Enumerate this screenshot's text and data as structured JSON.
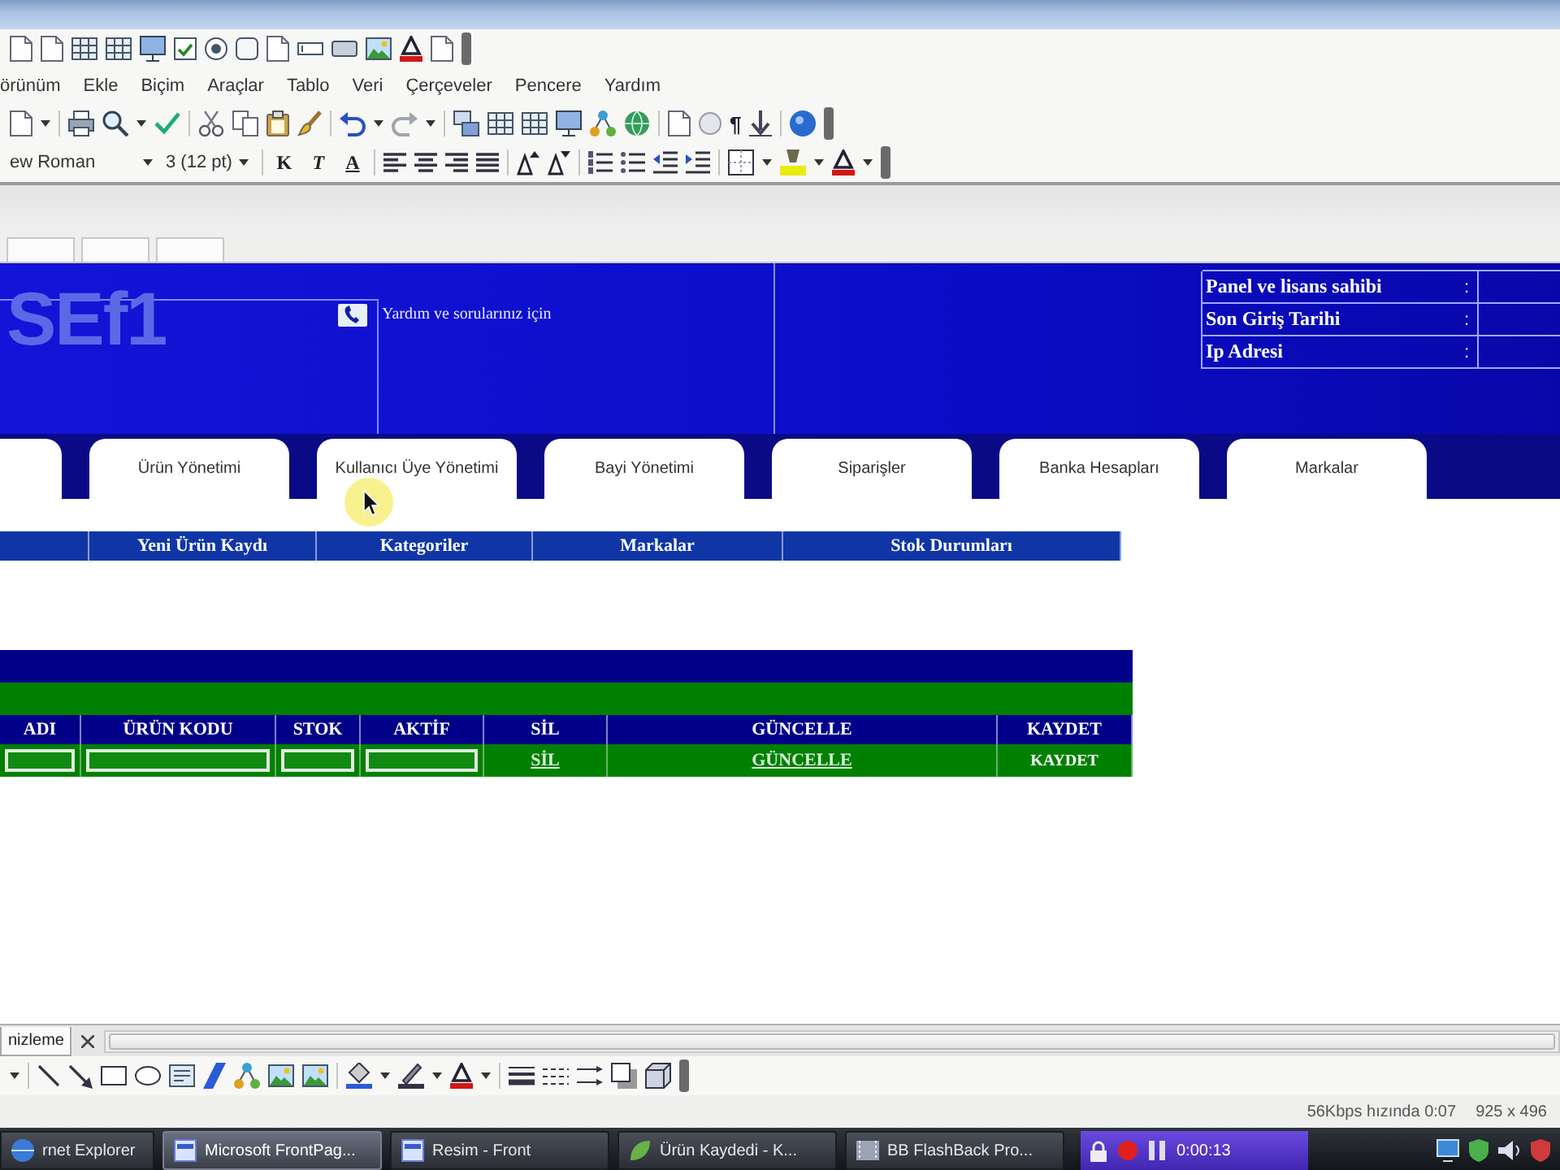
{
  "menu_bar": {
    "items": [
      "örünüm",
      "Ekle",
      "Biçim",
      "Araçlar",
      "Tablo",
      "Veri",
      "Çerçeveler",
      "Pencere",
      "Yardım"
    ]
  },
  "standard_toolbar": {
    "pilcrow": "¶"
  },
  "formatting_toolbar": {
    "font": "ew Roman",
    "size": "3 (12 pt)",
    "style_buttons": [
      "K",
      "T",
      "A"
    ]
  },
  "page": {
    "header": {
      "logo": "SEf1",
      "help_text": "Yardım ve sorularınız için",
      "info_rows": [
        {
          "label": "Panel ve lisans sahibi",
          "separator": ":"
        },
        {
          "label": "Son Giriş Tarihi",
          "separator": ":"
        },
        {
          "label": "Ip Adresi",
          "separator": ":"
        }
      ]
    },
    "tabs": [
      {
        "kind": "cut"
      },
      {
        "kind": "full",
        "label": "Ürün Yönetimi"
      },
      {
        "kind": "full",
        "label": "Kullanıcı Üye Yönetimi"
      },
      {
        "kind": "full",
        "label": "Bayi Yönetimi"
      },
      {
        "kind": "full",
        "label": "Siparişler"
      },
      {
        "kind": "full",
        "label": "Banka Hesapları"
      },
      {
        "kind": "full",
        "label": "Markalar"
      }
    ],
    "subnav": [
      {
        "kind": "cut"
      },
      {
        "kind": "full",
        "label": "Yeni Ürün Kaydı"
      },
      {
        "kind": "full",
        "label": "Kategoriler"
      },
      {
        "kind": "full",
        "label": "Markalar"
      },
      {
        "kind": "full",
        "label": "Stok Durumları"
      }
    ],
    "product_table": {
      "columns": [
        "ADI",
        "ÜRÜN KODU",
        "STOK",
        "AKTİF",
        "SİL",
        "GÜNCELLE",
        "KAYDET"
      ],
      "row": [
        {
          "kind": "input"
        },
        {
          "kind": "input"
        },
        {
          "kind": "input"
        },
        {
          "kind": "input"
        },
        {
          "kind": "link",
          "text": "SİL"
        },
        {
          "kind": "link",
          "text": "GÜNCELLE"
        },
        {
          "kind": "button",
          "text": "KAYDET"
        }
      ]
    }
  },
  "view_tabs": [
    {
      "label": "nizleme"
    }
  ],
  "status_bar": {
    "download_time": "56Kbps hızında 0:07",
    "page_size": "925 x 496"
  },
  "taskbar": {
    "items": [
      {
        "label": "rnet Explorer",
        "selected": false
      },
      {
        "label": "Microsoft FrontPag...",
        "selected": true
      },
      {
        "label": "Resim - Front",
        "selected": false
      },
      {
        "label": "Ürün Kaydedi - K...",
        "selected": false
      },
      {
        "label": "BB FlashBack Pro...",
        "selected": false
      }
    ],
    "timer": "0:00:13"
  }
}
